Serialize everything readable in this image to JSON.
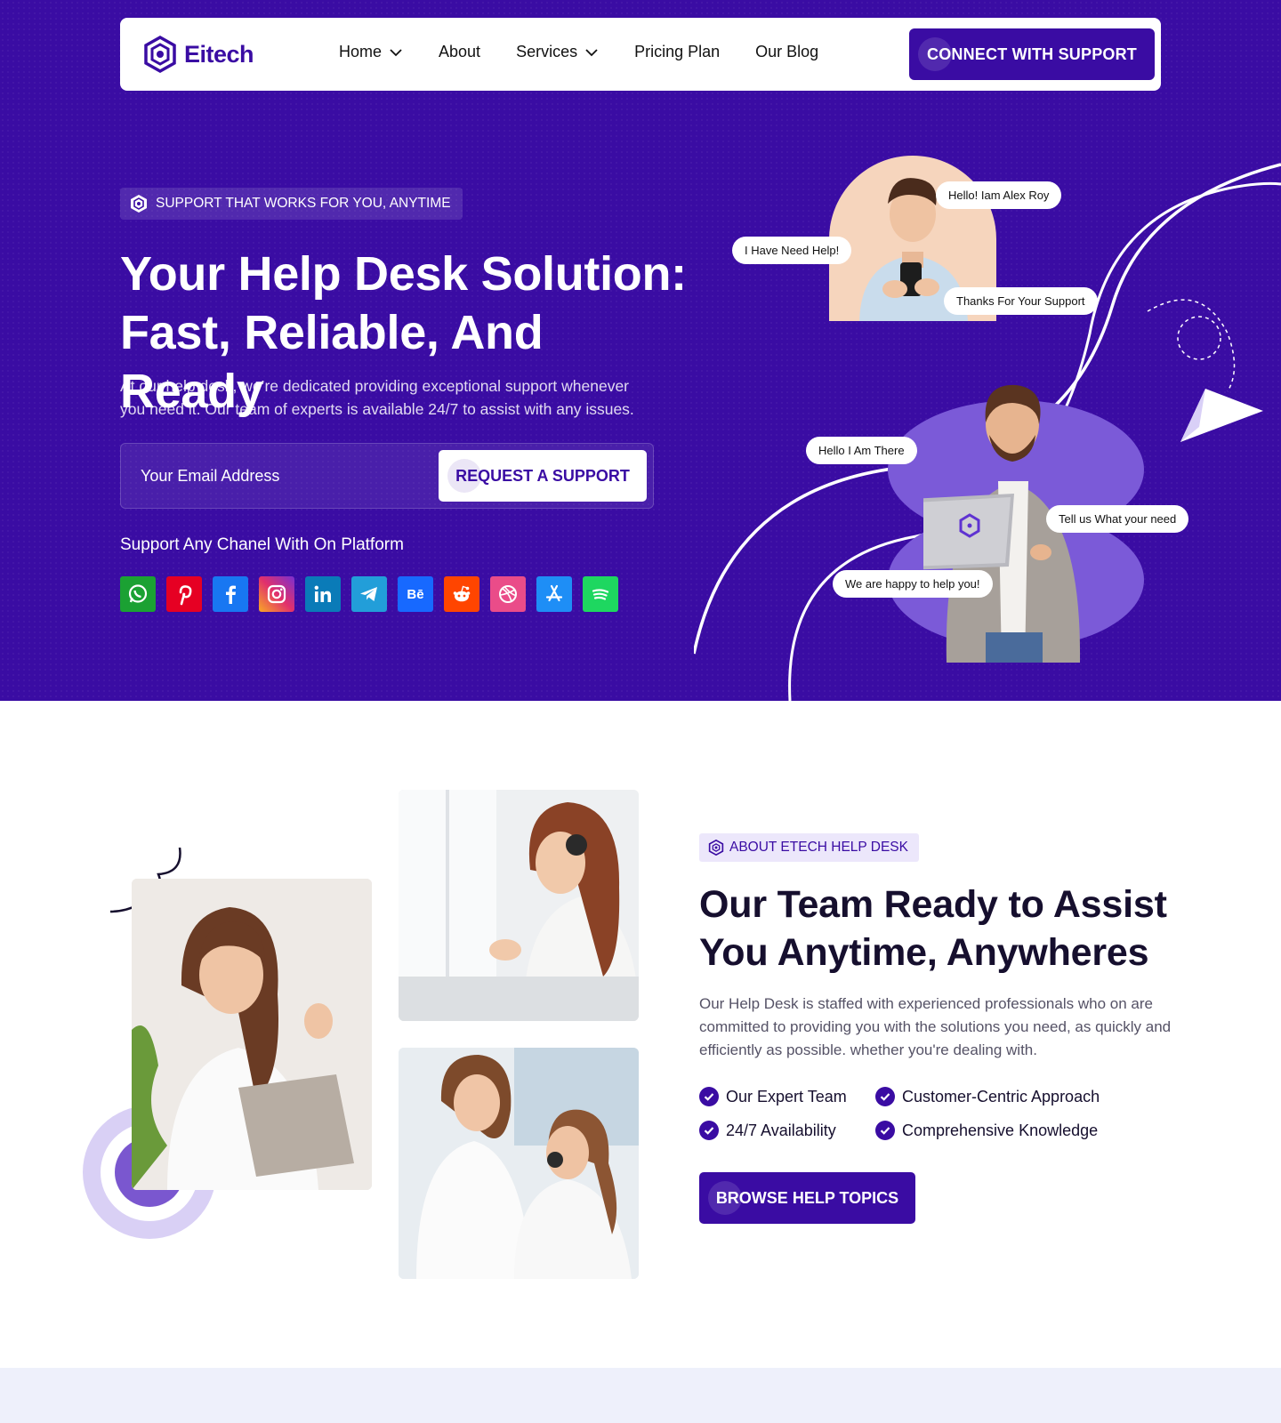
{
  "brand": {
    "name": "Eitech",
    "color": "#3a0ca3"
  },
  "nav": {
    "items": [
      {
        "label": "Home",
        "has_dropdown": true
      },
      {
        "label": "About",
        "has_dropdown": false
      },
      {
        "label": "Services",
        "has_dropdown": true
      },
      {
        "label": "Pricing Plan",
        "has_dropdown": false
      },
      {
        "label": "Our Blog",
        "has_dropdown": false
      }
    ],
    "cta_label": "CONNECT WITH SUPPORT"
  },
  "hero": {
    "tagline": "SUPPORT THAT WORKS FOR YOU, ANYTIME",
    "title_line1": "Your Help Desk Solution:",
    "title_line2": "Fast, Reliable, And Ready",
    "description": "At our help desk, we’re dedicated providing exceptional support whenever you need it. Our team of experts is available 24/7 to assist with any issues.",
    "email_placeholder": "Your Email Address",
    "request_button": "REQUEST A SUPPORT",
    "channels_title": "Support Any Chanel With On Platform",
    "channels": [
      {
        "icon": "whatsapp-icon",
        "color": "#1ba133"
      },
      {
        "icon": "pinterest-icon",
        "color": "#e60023"
      },
      {
        "icon": "facebook-icon",
        "color": "#1877f2"
      },
      {
        "icon": "instagram-icon",
        "color": "#d62976"
      },
      {
        "icon": "linkedin-icon",
        "color": "#0a7bb8"
      },
      {
        "icon": "telegram-icon",
        "color": "#229ed9"
      },
      {
        "icon": "behance-icon",
        "color": "#1769ff"
      },
      {
        "icon": "reddit-icon",
        "color": "#ff4500"
      },
      {
        "icon": "dribbble-icon",
        "color": "#ea4c89"
      },
      {
        "icon": "app-store-icon",
        "color": "#1e8ef6"
      },
      {
        "icon": "spotify-icon",
        "color": "#1ed760"
      }
    ],
    "behance_text": "Bē",
    "chats": {
      "alex": "Hello! Iam Alex Roy",
      "need_help": "I Have Need Help!",
      "thanks": "Thanks For Your Support",
      "hello_there": "Hello I Am There",
      "tell_us": "Tell us What your need",
      "happy": "We are happy to help you!"
    }
  },
  "about": {
    "tag": "ABOUT ETECH HELP DESK",
    "title_line1": "Our Team Ready to Assist",
    "title_line2": "You Anytime, Anywheres",
    "description": "Our Help Desk is staffed with experienced professionals who on are committed to providing you with the solutions you need, as quickly and efficiently as possible. whether you're dealing with.",
    "features": [
      "Our Expert Team",
      "Customer-Centric Approach",
      "24/7 Availability",
      "Comprehensive Knowledge"
    ],
    "button": "BROWSE HELP TOPICS"
  }
}
